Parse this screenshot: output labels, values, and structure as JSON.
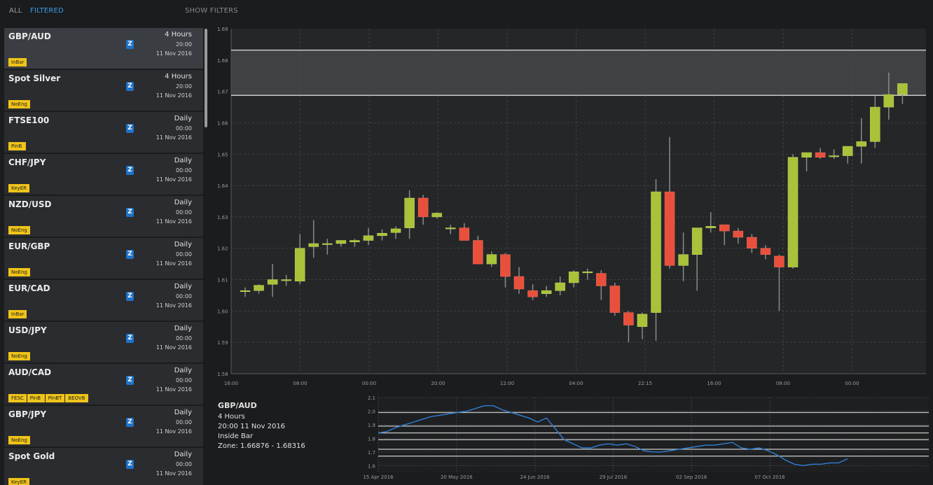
{
  "header": {
    "tab_all": "ALL",
    "tab_filtered": "FILTERED",
    "show_filters": "SHOW FILTERS"
  },
  "sidebar": {
    "items": [
      {
        "symbol": "GBP/AUD",
        "timeframe": "4 Hours",
        "time": "20:00",
        "date": "11 Nov 2016",
        "z": "Z",
        "tags": [
          "InBar"
        ],
        "selected": true
      },
      {
        "symbol": "Spot Silver",
        "timeframe": "4 Hours",
        "time": "20:00",
        "date": "11 Nov 2016",
        "z": "Z",
        "tags": [
          "NoEng"
        ]
      },
      {
        "symbol": "FTSE100",
        "timeframe": "Daily",
        "time": "00:00",
        "date": "11 Nov 2016",
        "z": "Z",
        "tags": [
          "PinB"
        ]
      },
      {
        "symbol": "CHF/JPY",
        "timeframe": "Daily",
        "time": "00:00",
        "date": "11 Nov 2016",
        "z": "Z",
        "tags": [
          "KeyER"
        ]
      },
      {
        "symbol": "NZD/USD",
        "timeframe": "Daily",
        "time": "00:00",
        "date": "11 Nov 2016",
        "z": "Z",
        "tags": [
          "NoEng"
        ]
      },
      {
        "symbol": "EUR/GBP",
        "timeframe": "Daily",
        "time": "00:00",
        "date": "11 Nov 2016",
        "z": "Z",
        "tags": [
          "NoEng"
        ]
      },
      {
        "symbol": "EUR/CAD",
        "timeframe": "Daily",
        "time": "00:00",
        "date": "11 Nov 2016",
        "z": "Z",
        "tags": [
          "InBar"
        ]
      },
      {
        "symbol": "USD/JPY",
        "timeframe": "Daily",
        "time": "00:00",
        "date": "11 Nov 2016",
        "z": "Z",
        "tags": [
          "NoEng"
        ]
      },
      {
        "symbol": "AUD/CAD",
        "timeframe": "Daily",
        "time": "00:00",
        "date": "11 Nov 2016",
        "z": "Z",
        "tags": [
          "FESC",
          "PinB",
          "PinBT",
          "BEOVB"
        ]
      },
      {
        "symbol": "GBP/JPY",
        "timeframe": "Daily",
        "time": "00:00",
        "date": "11 Nov 2016",
        "z": "Z",
        "tags": [
          "NoEng"
        ]
      },
      {
        "symbol": "Spot Gold",
        "timeframe": "Daily",
        "time": "00:00",
        "date": "11 Nov 2016",
        "z": "Z",
        "tags": [
          "KeyER"
        ]
      }
    ]
  },
  "info": {
    "symbol": "GBP/AUD",
    "timeframe": "4 Hours",
    "datetime": "20:00 11 Nov 2016",
    "pattern": "Inside Bar",
    "zone": "Zone: 1.66876 - 1.68316"
  },
  "colors": {
    "accent": "#3d9be9",
    "up": "#a8c23a",
    "down": "#e8503c",
    "tag": "#f0c419",
    "line": "#2f7fd6"
  },
  "chart_data": [
    {
      "type": "candlestick",
      "ylim": [
        1.58,
        1.69
      ],
      "y_ticks": [
        "1.69",
        "1.68",
        "1.67",
        "1.66",
        "1.65",
        "1.64",
        "1.63",
        "1.62",
        "1.61",
        "1.60",
        "1.59",
        "1.58"
      ],
      "x_ticks": [
        "16:00",
        "08:00",
        "00:00",
        "20:00",
        "12:00",
        "04:00",
        "22:15",
        "16:00",
        "08:00",
        "00:00"
      ],
      "zone": [
        1.66876,
        1.68316
      ],
      "candles": [
        {
          "o": 1.6065,
          "h": 1.6075,
          "l": 1.6045,
          "c": 1.6065
        },
        {
          "o": 1.6065,
          "h": 1.6085,
          "l": 1.6055,
          "c": 1.6082
        },
        {
          "o": 1.6085,
          "h": 1.615,
          "l": 1.6045,
          "c": 1.61
        },
        {
          "o": 1.61,
          "h": 1.6115,
          "l": 1.608,
          "c": 1.61
        },
        {
          "o": 1.6095,
          "h": 1.6245,
          "l": 1.6085,
          "c": 1.62
        },
        {
          "o": 1.6205,
          "h": 1.629,
          "l": 1.617,
          "c": 1.6215
        },
        {
          "o": 1.6215,
          "h": 1.623,
          "l": 1.618,
          "c": 1.6215
        },
        {
          "o": 1.6215,
          "h": 1.6225,
          "l": 1.6205,
          "c": 1.6225
        },
        {
          "o": 1.622,
          "h": 1.623,
          "l": 1.6205,
          "c": 1.6225
        },
        {
          "o": 1.6225,
          "h": 1.6265,
          "l": 1.621,
          "c": 1.624
        },
        {
          "o": 1.624,
          "h": 1.626,
          "l": 1.6225,
          "c": 1.6248
        },
        {
          "o": 1.625,
          "h": 1.627,
          "l": 1.623,
          "c": 1.6262
        },
        {
          "o": 1.6265,
          "h": 1.6385,
          "l": 1.623,
          "c": 1.636
        },
        {
          "o": 1.636,
          "h": 1.637,
          "l": 1.6275,
          "c": 1.63
        },
        {
          "o": 1.63,
          "h": 1.6315,
          "l": 1.6295,
          "c": 1.6312
        },
        {
          "o": 1.6265,
          "h": 1.6275,
          "l": 1.6245,
          "c": 1.6265
        },
        {
          "o": 1.6265,
          "h": 1.628,
          "l": 1.623,
          "c": 1.6225
        },
        {
          "o": 1.6225,
          "h": 1.624,
          "l": 1.615,
          "c": 1.615
        },
        {
          "o": 1.615,
          "h": 1.619,
          "l": 1.614,
          "c": 1.618
        },
        {
          "o": 1.618,
          "h": 1.6185,
          "l": 1.6075,
          "c": 1.611
        },
        {
          "o": 1.611,
          "h": 1.614,
          "l": 1.6055,
          "c": 1.607
        },
        {
          "o": 1.6065,
          "h": 1.6085,
          "l": 1.6035,
          "c": 1.6045
        },
        {
          "o": 1.6055,
          "h": 1.608,
          "l": 1.6045,
          "c": 1.6065
        },
        {
          "o": 1.6065,
          "h": 1.611,
          "l": 1.605,
          "c": 1.609
        },
        {
          "o": 1.609,
          "h": 1.613,
          "l": 1.6075,
          "c": 1.6125
        },
        {
          "o": 1.6125,
          "h": 1.6135,
          "l": 1.61,
          "c": 1.6125
        },
        {
          "o": 1.612,
          "h": 1.613,
          "l": 1.6035,
          "c": 1.608
        },
        {
          "o": 1.608,
          "h": 1.609,
          "l": 1.5985,
          "c": 1.5995
        },
        {
          "o": 1.5995,
          "h": 1.6,
          "l": 1.59,
          "c": 1.5955
        },
        {
          "o": 1.595,
          "h": 1.5995,
          "l": 1.591,
          "c": 1.599
        },
        {
          "o": 1.5995,
          "h": 1.642,
          "l": 1.5905,
          "c": 1.638
        },
        {
          "o": 1.638,
          "h": 1.6555,
          "l": 1.6135,
          "c": 1.6145
        },
        {
          "o": 1.6145,
          "h": 1.625,
          "l": 1.6095,
          "c": 1.618
        },
        {
          "o": 1.618,
          "h": 1.6265,
          "l": 1.6065,
          "c": 1.6265
        },
        {
          "o": 1.6265,
          "h": 1.6315,
          "l": 1.625,
          "c": 1.627
        },
        {
          "o": 1.6275,
          "h": 1.6275,
          "l": 1.621,
          "c": 1.6255
        },
        {
          "o": 1.6255,
          "h": 1.6265,
          "l": 1.6215,
          "c": 1.6235
        },
        {
          "o": 1.6235,
          "h": 1.6245,
          "l": 1.6185,
          "c": 1.62
        },
        {
          "o": 1.62,
          "h": 1.621,
          "l": 1.6165,
          "c": 1.618
        },
        {
          "o": 1.6175,
          "h": 1.618,
          "l": 1.6,
          "c": 1.614
        },
        {
          "o": 1.614,
          "h": 1.65,
          "l": 1.6135,
          "c": 1.649
        },
        {
          "o": 1.649,
          "h": 1.6505,
          "l": 1.6445,
          "c": 1.6505
        },
        {
          "o": 1.6505,
          "h": 1.652,
          "l": 1.6485,
          "c": 1.649
        },
        {
          "o": 1.6495,
          "h": 1.6515,
          "l": 1.6485,
          "c": 1.6495
        },
        {
          "o": 1.6495,
          "h": 1.6525,
          "l": 1.647,
          "c": 1.6525
        },
        {
          "o": 1.6525,
          "h": 1.6615,
          "l": 1.647,
          "c": 1.654
        },
        {
          "o": 1.654,
          "h": 1.6685,
          "l": 1.652,
          "c": 1.665
        },
        {
          "o": 1.665,
          "h": 1.676,
          "l": 1.661,
          "c": 1.669
        },
        {
          "o": 1.669,
          "h": 1.6725,
          "l": 1.666,
          "c": 1.6725
        }
      ]
    },
    {
      "type": "line",
      "ylim": [
        1.55,
        2.1
      ],
      "y_ticks": [
        "2.1",
        "2.0",
        "1.9",
        "1.8",
        "1.7",
        "1.6"
      ],
      "x_ticks": [
        "15 Apr 2016",
        "20 May 2016",
        "24 Jun 2016",
        "29 Jul 2016",
        "02 Sep 2016",
        "07 Oct 2016"
      ],
      "levels": [
        1.99,
        1.89,
        1.84,
        1.79,
        1.72,
        1.67
      ],
      "values": [
        1.84,
        1.85,
        1.88,
        1.9,
        1.92,
        1.94,
        1.96,
        1.97,
        1.98,
        1.99,
        2.0,
        2.02,
        2.04,
        2.04,
        2.01,
        1.99,
        1.97,
        1.95,
        1.92,
        1.95,
        1.87,
        1.79,
        1.76,
        1.73,
        1.73,
        1.75,
        1.76,
        1.75,
        1.76,
        1.74,
        1.71,
        1.7,
        1.7,
        1.71,
        1.72,
        1.73,
        1.74,
        1.75,
        1.75,
        1.76,
        1.77,
        1.73,
        1.72,
        1.73,
        1.71,
        1.68,
        1.64,
        1.61,
        1.6,
        1.61,
        1.61,
        1.62,
        1.62,
        1.65
      ]
    }
  ]
}
